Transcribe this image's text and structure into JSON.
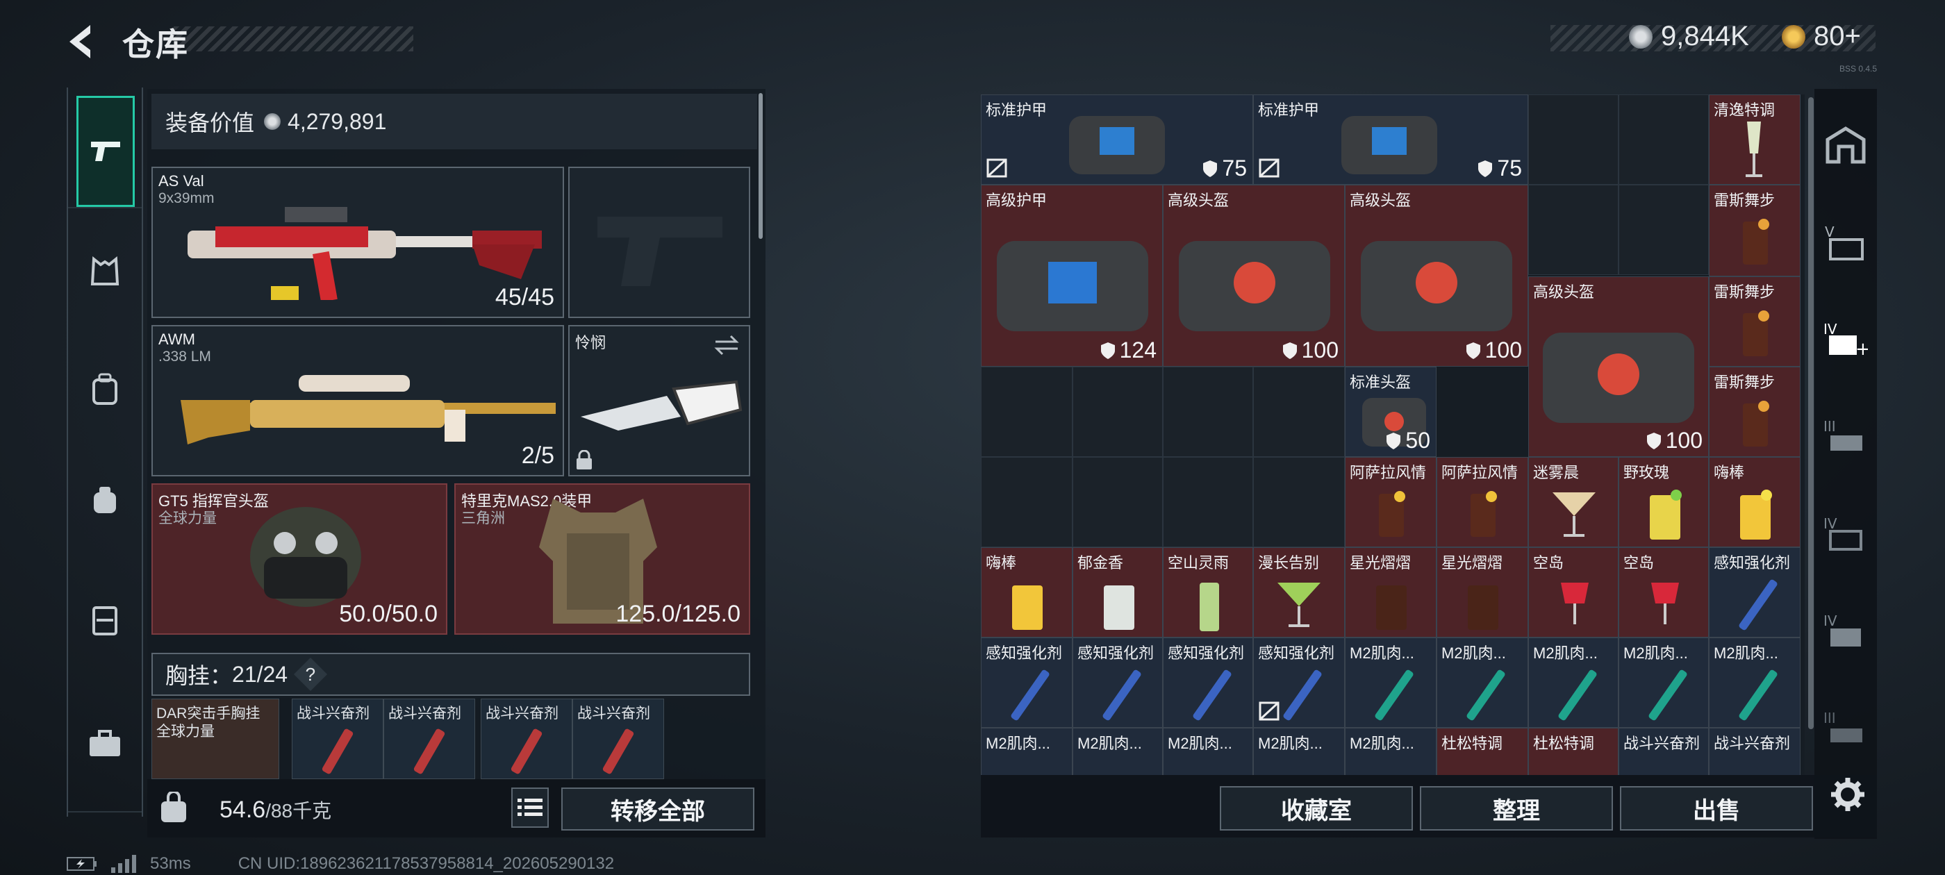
{
  "header": {
    "title": "仓库",
    "currency1": "9,844K",
    "currency2": "80+",
    "version": "BSS 0.4.5"
  },
  "sidebar": {
    "items": [
      "weapon-icon",
      "armor-icon",
      "chest-rig-icon",
      "backpack-icon",
      "container-icon",
      "toolbox-icon"
    ]
  },
  "equipment": {
    "value_label": "装备价值",
    "value": "4,279,891"
  },
  "slots": {
    "primary": {
      "name": "AS Val",
      "sub": "9x39mm",
      "ammo": "45/45"
    },
    "sniper": {
      "name": "AWM",
      "sub": ".338 LM",
      "ammo": "2/5"
    },
    "melee": {
      "name": "怜悯"
    },
    "helmet": {
      "name": "GT5 指挥官头盔",
      "sub": "全球力量",
      "dur": "50.0/50.0"
    },
    "armor": {
      "name": "特里克MAS2.0装甲",
      "sub": "三角洲",
      "dur": "125.0/125.0"
    }
  },
  "vest": {
    "label": "胸挂：",
    "capacity": "21/24",
    "help": "?",
    "name": "DAR突击手胸挂",
    "sub": "全球力量",
    "items": [
      "战斗兴奋剂",
      "战斗兴奋剂",
      "战斗兴奋剂",
      "战斗兴奋剂"
    ]
  },
  "weight": {
    "value": "54.6",
    "max": "/88千克"
  },
  "buttons": {
    "transfer_all": "转移全部",
    "collection": "收藏室",
    "organize": "整理",
    "sell": "出售"
  },
  "grid": {
    "cells": [
      {
        "name": "标准护甲",
        "dur": "75",
        "bg": "b"
      },
      {
        "name": "标准护甲",
        "dur": "75",
        "bg": "b"
      },
      {
        "name": "清逸特调",
        "dur": "",
        "bg": "r"
      },
      {
        "name": "高级护甲",
        "dur": "124",
        "bg": "r"
      },
      {
        "name": "高级头盔",
        "dur": "100",
        "bg": "r"
      },
      {
        "name": "高级头盔",
        "dur": "100",
        "bg": "r"
      },
      {
        "name": "雷斯舞步",
        "dur": "",
        "bg": "r"
      },
      {
        "name": "高级头盔",
        "dur": "100",
        "bg": "r"
      },
      {
        "name": "雷斯舞步",
        "dur": "",
        "bg": "r"
      },
      {
        "name": "雷斯舞步",
        "dur": "",
        "bg": "r"
      },
      {
        "name": "标准头盔",
        "dur": "50",
        "bg": "b"
      },
      {
        "name": "阿萨拉风情",
        "dur": "",
        "bg": "r"
      },
      {
        "name": "阿萨拉风情",
        "dur": "",
        "bg": "r"
      },
      {
        "name": "迷雾晨",
        "dur": "",
        "bg": "r"
      },
      {
        "name": "野玫瑰",
        "dur": "",
        "bg": "r"
      },
      {
        "name": "嗨棒",
        "dur": "",
        "bg": "r"
      },
      {
        "name": "嗨棒",
        "dur": "",
        "bg": "r"
      },
      {
        "name": "郁金香",
        "dur": "",
        "bg": "r"
      },
      {
        "name": "空山灵雨",
        "dur": "",
        "bg": "r"
      },
      {
        "name": "漫长告别",
        "dur": "",
        "bg": "r"
      },
      {
        "name": "星光熠熠",
        "dur": "",
        "bg": "r"
      },
      {
        "name": "星光熠熠",
        "dur": "",
        "bg": "r"
      },
      {
        "name": "空岛",
        "dur": "",
        "bg": "r"
      },
      {
        "name": "空岛",
        "dur": "",
        "bg": "r"
      },
      {
        "name": "感知强化剂",
        "dur": "",
        "bg": "b"
      },
      {
        "name": "感知强化剂",
        "dur": "",
        "bg": "b"
      },
      {
        "name": "感知强化剂",
        "dur": "",
        "bg": "b"
      },
      {
        "name": "感知强化剂",
        "dur": "",
        "bg": "b"
      },
      {
        "name": "感知强化剂",
        "dur": "",
        "bg": "b"
      },
      {
        "name": "M2肌肉...",
        "dur": "",
        "bg": "b"
      },
      {
        "name": "M2肌肉...",
        "dur": "",
        "bg": "b"
      },
      {
        "name": "M2肌肉...",
        "dur": "",
        "bg": "b"
      },
      {
        "name": "M2肌肉...",
        "dur": "",
        "bg": "b"
      },
      {
        "name": "M2肌肉...",
        "dur": "",
        "bg": "b"
      },
      {
        "name": "M2肌肉...",
        "dur": "",
        "bg": "b"
      },
      {
        "name": "M2肌肉...",
        "dur": "",
        "bg": "b"
      },
      {
        "name": "M2肌肉...",
        "dur": "",
        "bg": "b"
      },
      {
        "name": "M2肌肉...",
        "dur": "",
        "bg": "b"
      },
      {
        "name": "M2肌肉...",
        "dur": "",
        "bg": "b"
      },
      {
        "name": "杜松特调",
        "dur": "",
        "bg": "r"
      },
      {
        "name": "杜松特调",
        "dur": "",
        "bg": "r"
      },
      {
        "name": "战斗兴奋剂",
        "dur": "",
        "bg": "b"
      },
      {
        "name": "战斗兴奋剂",
        "dur": "",
        "bg": "b"
      }
    ]
  },
  "rail": {
    "items": [
      "safehouse-icon",
      "V-icon",
      "IV-plus-icon",
      "III-icon",
      "IV-icon",
      "IV-folder-icon",
      "III-bed-icon",
      "settings-icon"
    ]
  },
  "status": {
    "ping": "53ms",
    "uid": "CN UID:18962362117853795881​4_202605290132"
  },
  "colors": {
    "accent": "#25c9a6",
    "red_bg": "#4d2327",
    "blue_bg": "#202b3b"
  }
}
